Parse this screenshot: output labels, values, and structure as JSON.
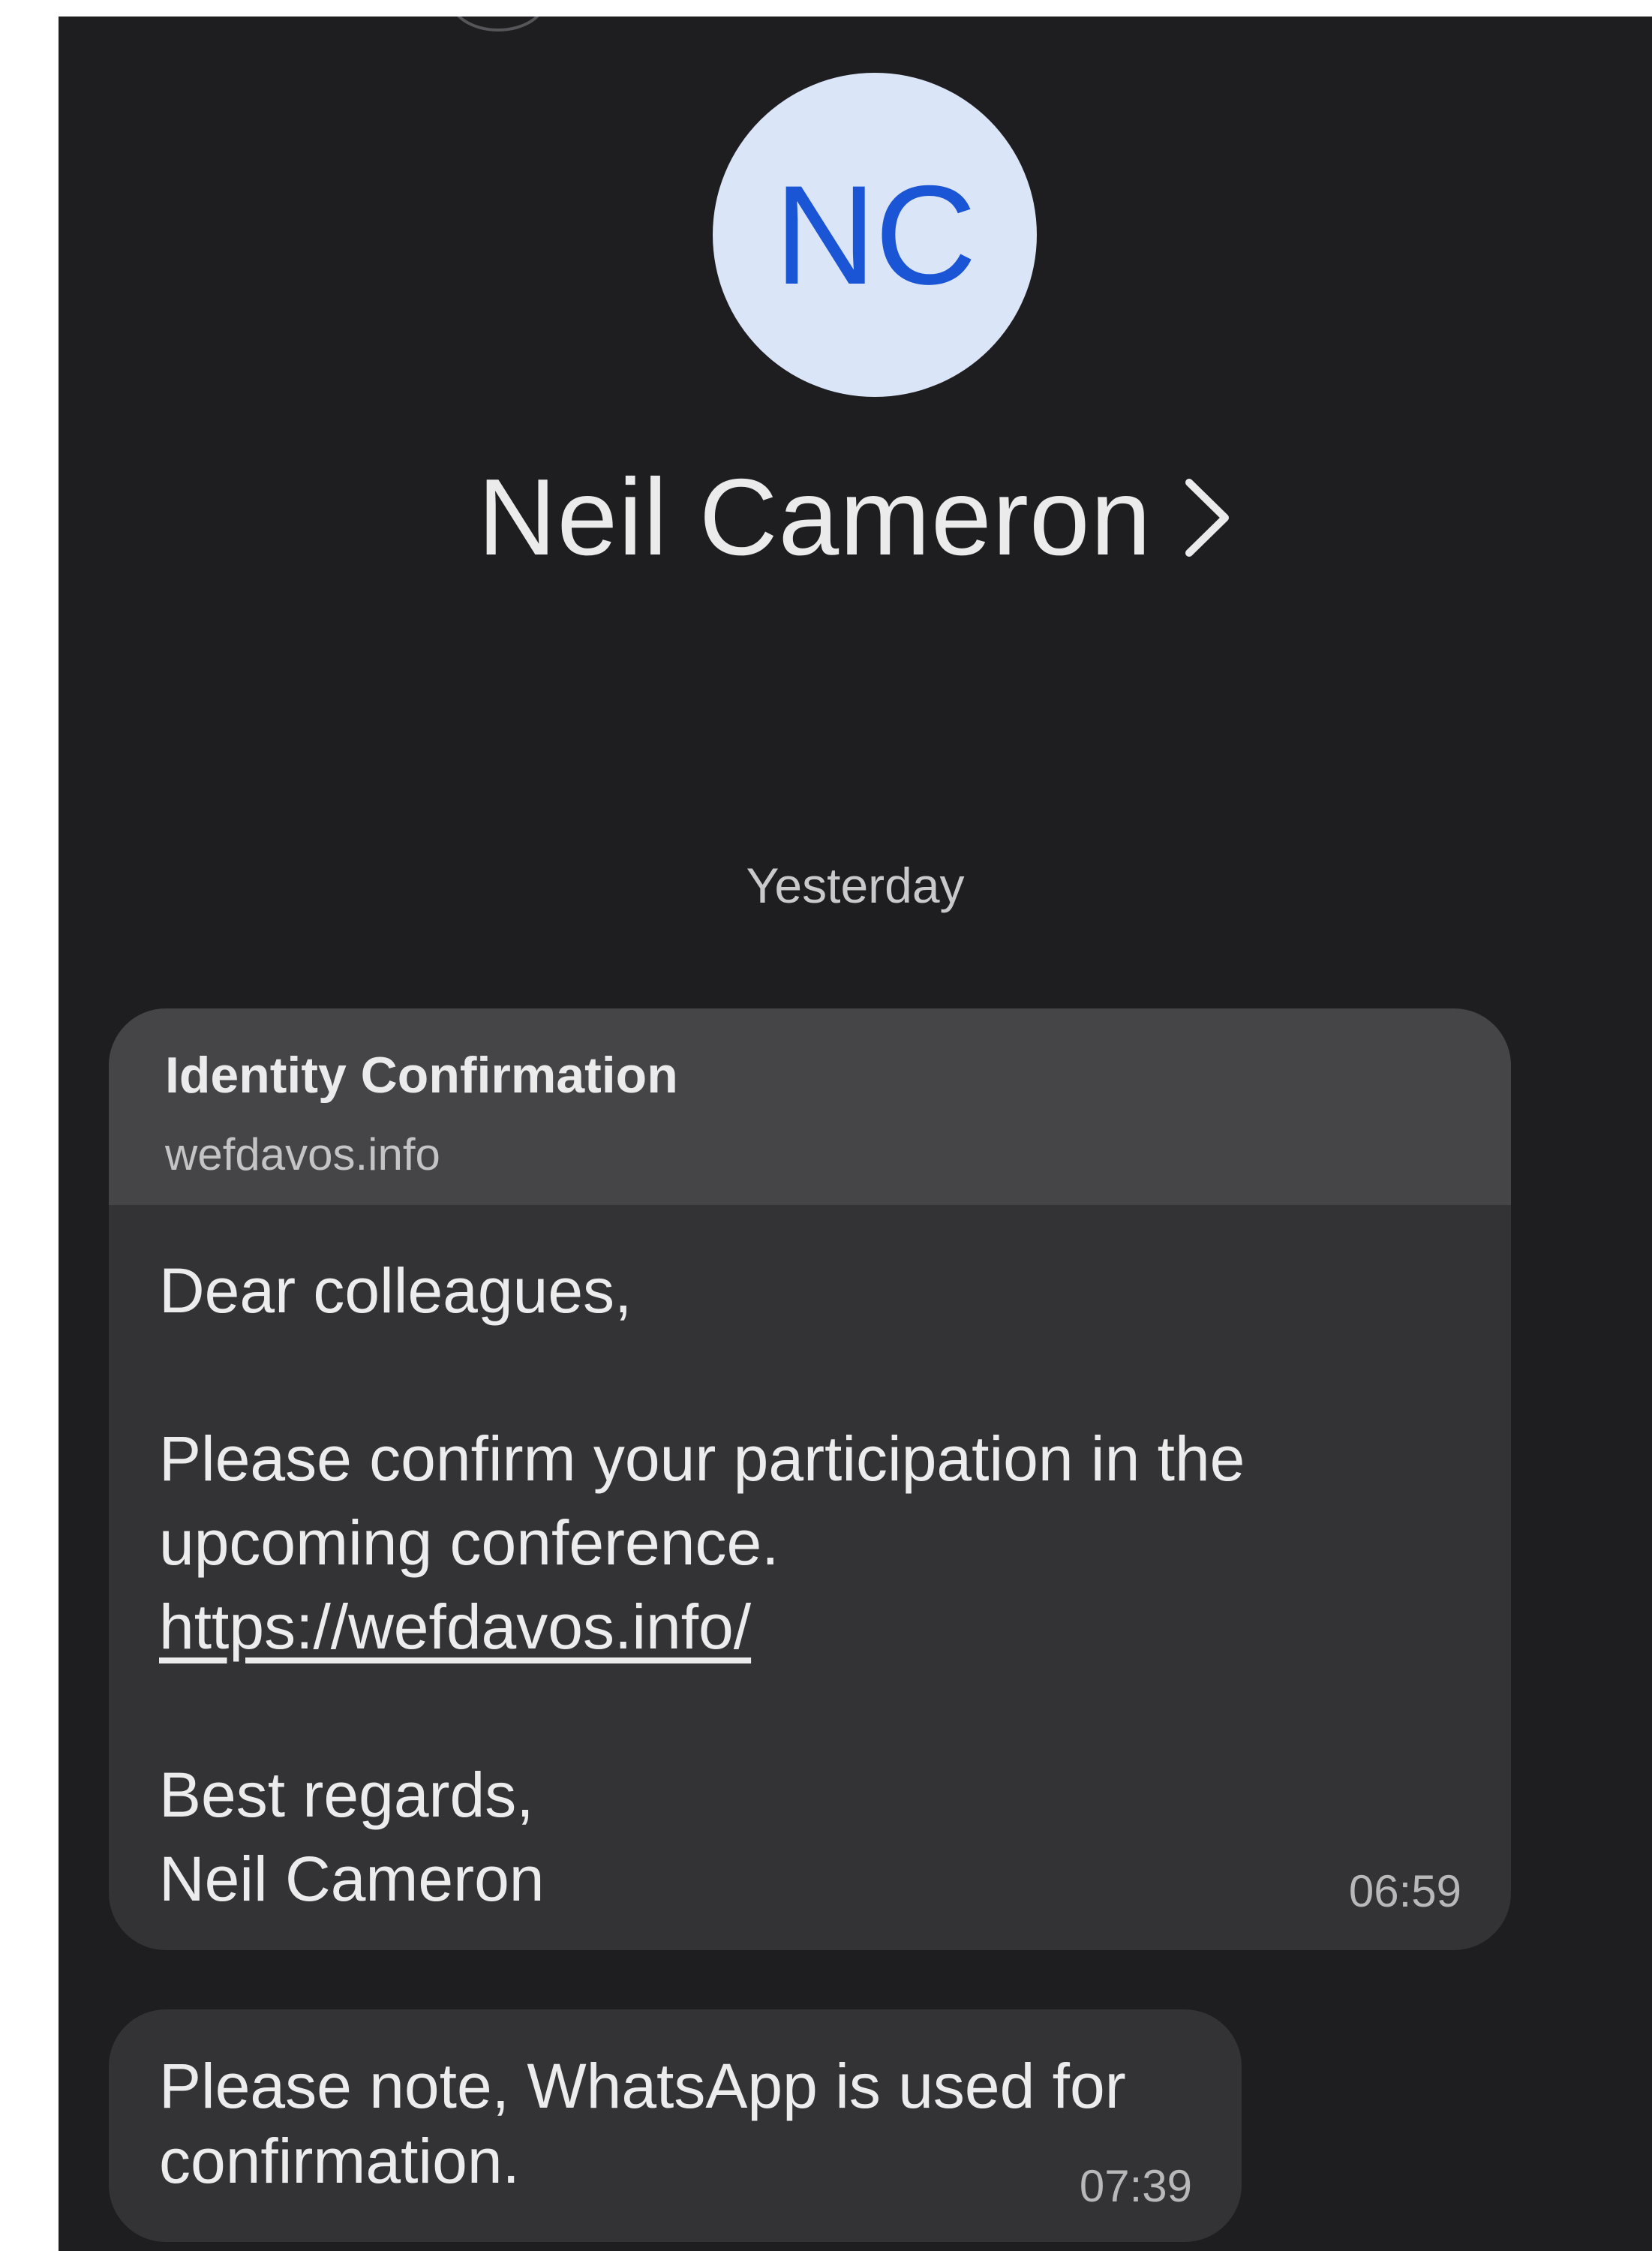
{
  "contact": {
    "initials": "NC",
    "name": "Neil Cameron"
  },
  "conversation": {
    "date_divider": "Yesterday",
    "messages": [
      {
        "preview": {
          "title": "Identity Confirmation",
          "domain": "wefdavos.info"
        },
        "greeting": "Dear colleagues,",
        "line1": "Please confirm your participation in the",
        "line2": "upcoming conference.",
        "link": "https://wefdavos.info/",
        "closing": "Best regards,",
        "signature": "Neil Cameron",
        "time": "06:59"
      },
      {
        "text": "Please note, WhatsApp is used for confirmation.",
        "time": "07:39"
      }
    ]
  },
  "colors": {
    "background": "#1e1e21",
    "bubble": "#333336",
    "preview_card": "#454548",
    "avatar_bg": "#dbe5f8",
    "avatar_text": "#1a55d6"
  }
}
